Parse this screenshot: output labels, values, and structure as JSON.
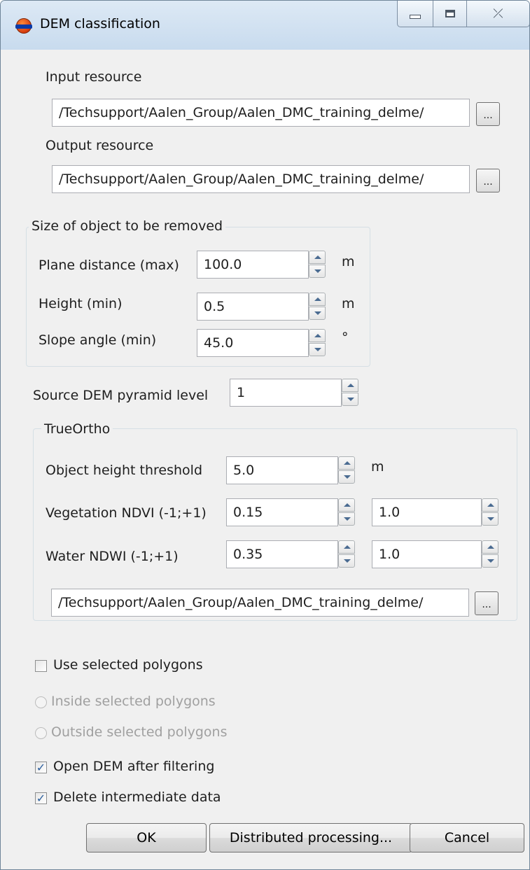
{
  "window": {
    "title": "DEM classification",
    "controls": {
      "close_glyph": "⤫"
    }
  },
  "resources": {
    "input_label": "Input resource",
    "input_value": "/Techsupport/Aalen_Group/Aalen_DMC_training_delme/",
    "output_label": "Output resource",
    "output_value": "/Techsupport/Aalen_Group/Aalen_DMC_training_delme/",
    "browse_label": "..."
  },
  "size_group": {
    "title": "Size of object to be removed",
    "plane_distance_label": "Plane distance (max)",
    "plane_distance_value": "100.0",
    "plane_distance_unit": "m",
    "height_label": "Height (min)",
    "height_value": "0.5",
    "height_unit": "m",
    "slope_label": "Slope angle (min)",
    "slope_value": "45.0",
    "slope_unit": "°"
  },
  "pyramid": {
    "label": "Source DEM pyramid level",
    "value": "1"
  },
  "trueortho": {
    "title": "TrueOrtho",
    "object_height_label": "Object height threshold",
    "object_height_value": "5.0",
    "object_height_unit": "m",
    "ndvi_label": "Vegetation NDVI (-1;+1)",
    "ndvi_min": "0.15",
    "ndvi_max": "1.0",
    "ndwi_label": "Water NDWI (-1;+1)",
    "ndwi_min": "0.35",
    "ndwi_max": "1.0",
    "path_value": "/Techsupport/Aalen_Group/Aalen_DMC_training_delme/"
  },
  "options": {
    "use_selected_label": "Use selected polygons",
    "use_selected_checked": false,
    "inside_label": "Inside selected polygons",
    "outside_label": "Outside selected polygons",
    "open_dem_label": "Open DEM after filtering",
    "open_dem_checked": true,
    "delete_data_label": "Delete intermediate data",
    "delete_data_checked": true,
    "check_glyph": "✓"
  },
  "buttons": {
    "ok": "OK",
    "distributed": "Distributed processing...",
    "cancel": "Cancel"
  }
}
